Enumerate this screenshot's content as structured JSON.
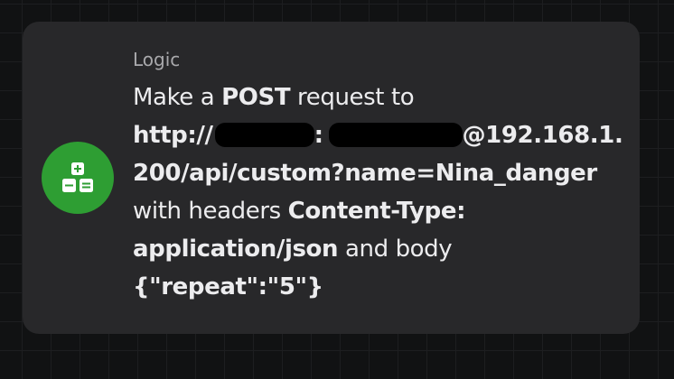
{
  "card": {
    "category": "Logic",
    "icon": "calculator-icon",
    "icon_color": "#2e9e33",
    "lines": {
      "l1_pre": "Make a ",
      "l1_method": "POST",
      "l1_post": " request to",
      "l2_scheme": "http://",
      "l2_sep": ":",
      "l2_host_a": "@192.168.1.",
      "l3_path": "200/api/custom?name=Nina_danger",
      "l4_pre": "with headers ",
      "l4_header": "Content-Type:",
      "l5_value": "application/json",
      "l5_post": " and body",
      "l6_body": "{\"repeat\":\"5\"}"
    }
  }
}
